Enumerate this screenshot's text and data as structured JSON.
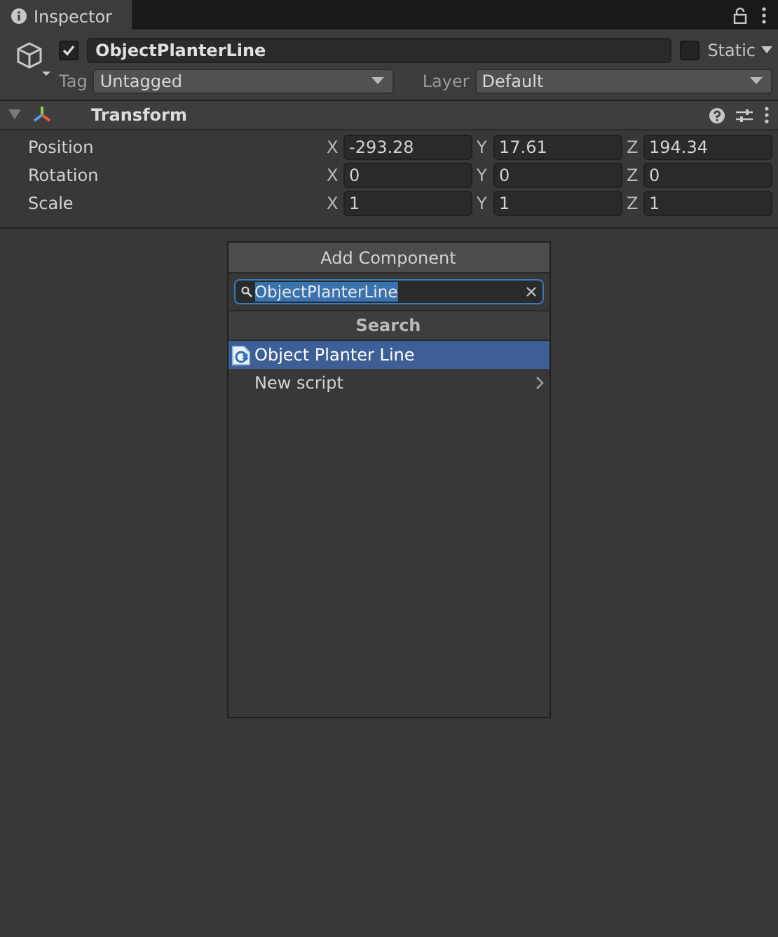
{
  "tab": {
    "title": "Inspector",
    "selected": true
  },
  "object": {
    "active": true,
    "name": "ObjectPlanterLine",
    "static": false,
    "static_label": "Static",
    "tag_label": "Tag",
    "tag": "Untagged",
    "layer_label": "Layer",
    "layer": "Default"
  },
  "component": {
    "title": "Transform",
    "expanded": true,
    "rows": [
      {
        "label": "Position",
        "fields": [
          {
            "axis": "X",
            "value": "-293.28"
          },
          {
            "axis": "Y",
            "value": "17.61"
          },
          {
            "axis": "Z",
            "value": "194.34"
          }
        ]
      },
      {
        "label": "Rotation",
        "fields": [
          {
            "axis": "X",
            "value": "0"
          },
          {
            "axis": "Y",
            "value": "0"
          },
          {
            "axis": "Z",
            "value": "0"
          }
        ]
      },
      {
        "label": "Scale",
        "fields": [
          {
            "axis": "X",
            "value": "1"
          },
          {
            "axis": "Y",
            "value": "1"
          },
          {
            "axis": "Z",
            "value": "1"
          }
        ]
      }
    ]
  },
  "add_component": {
    "button": "Add Component",
    "search": {
      "value": "ObjectPlanterLine",
      "value_selected": true
    },
    "header": "Search",
    "items": [
      {
        "kind": "script",
        "label": "Object Planter Line",
        "selected": true
      },
      {
        "kind": "submenu",
        "label": "New script",
        "selected": false
      }
    ]
  }
}
